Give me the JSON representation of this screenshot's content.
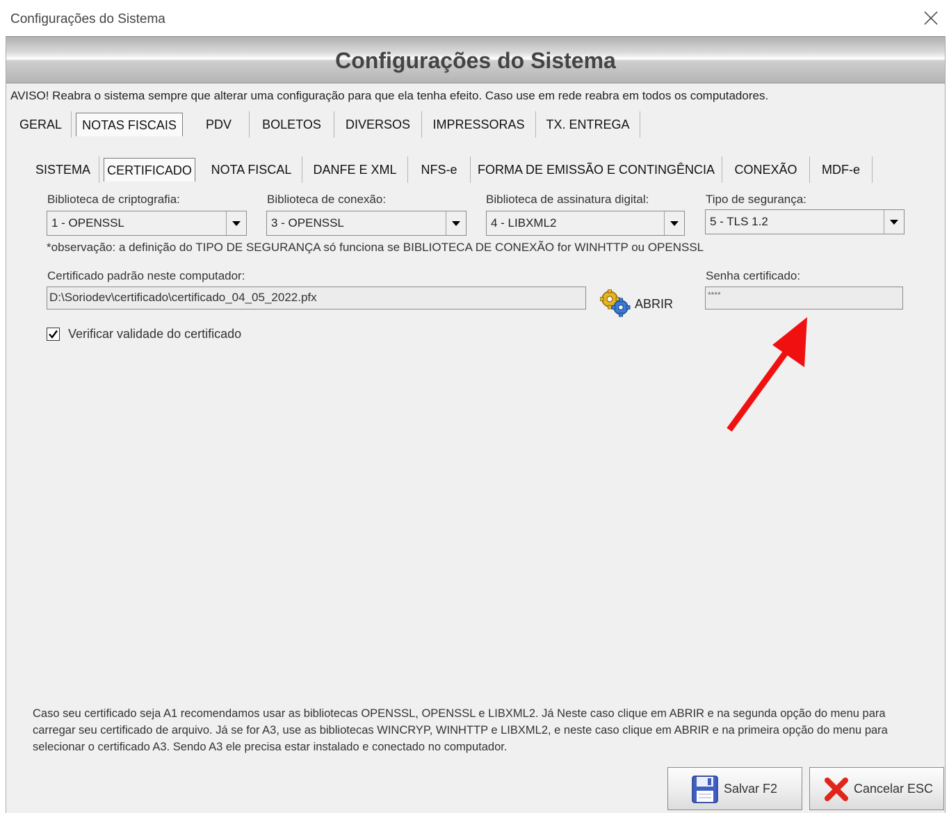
{
  "window": {
    "title": "Configurações do Sistema"
  },
  "banner": {
    "heading": "Configurações do Sistema"
  },
  "warning": "AVISO! Reabra o sistema sempre que alterar uma configuração para que ela tenha efeito. Caso use em rede reabra em todos os computadores.",
  "top_tabs": [
    "GERAL",
    "NOTAS FISCAIS",
    "PDV",
    "BOLETOS",
    "DIVERSOS",
    "IMPRESSORAS",
    "TX. ENTREGA"
  ],
  "top_tabs_active": "NOTAS FISCAIS",
  "sub_tabs": [
    "SISTEMA",
    "CERTIFICADO",
    "NOTA FISCAL",
    "DANFE E XML",
    "NFS-e",
    "FORMA DE EMISSÃO E CONTINGÊNCIA",
    "CONEXÃO",
    "MDF-e"
  ],
  "sub_tabs_active": "CERTIFICADO",
  "form": {
    "crypto_label": "Biblioteca de criptografia:",
    "crypto_value": "1 - OPENSSL",
    "conn_label": "Biblioteca de conexão:",
    "conn_value": "3 - OPENSSL",
    "sign_label": "Biblioteca de assinatura digital:",
    "sign_value": "4 - LIBXML2",
    "security_label": "Tipo de segurança:",
    "security_value": "5 - TLS 1.2",
    "note": "*observação: a definição do TIPO DE SEGURANÇA só funciona se BIBLIOTECA DE CONEXÃO for WINHTTP ou OPENSSL",
    "cert_label": "Certificado padrão neste computador:",
    "cert_value": "D:\\Soriodev\\certificado\\certificado_04_05_2022.pfx",
    "open_button": "ABRIR",
    "password_label": "Senha certificado:",
    "password_value": "****",
    "verify_checked": true,
    "verify_label": "Verificar validade do certificado"
  },
  "info_text": "Caso seu certificado seja A1 recomendamos usar as bibliotecas OPENSSL, OPENSSL e LIBXML2. Já Neste caso clique em ABRIR e na segunda opção do menu para carregar seu certificado de arquivo. Já se for A3, use as bibliotecas WINCRYP, WINHTTP e LIBXML2, e neste caso clique em ABRIR e na primeira opção do menu para selecionar o certificado A3. Sendo A3 ele precisa estar instalado e conectado no computador.",
  "buttons": {
    "save": "Salvar F2",
    "cancel": "Cancelar ESC"
  },
  "colors": {
    "arrow": "#f01010",
    "background": "#f0f0f0"
  }
}
